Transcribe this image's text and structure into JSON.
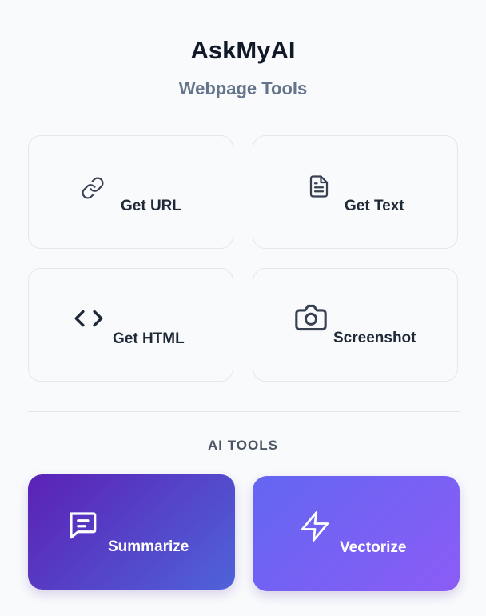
{
  "app": {
    "title": "AskMyAI",
    "subtitle": "Webpage Tools"
  },
  "tools": [
    {
      "label": "Get URL",
      "icon": "link-icon"
    },
    {
      "label": "Get Text",
      "icon": "document-icon"
    },
    {
      "label": "Get HTML",
      "icon": "code-icon"
    },
    {
      "label": "Screenshot",
      "icon": "camera-icon"
    }
  ],
  "ai_section": {
    "heading": "AI TOOLS",
    "tools": [
      {
        "label": "Summarize",
        "icon": "chat-icon"
      },
      {
        "label": "Vectorize",
        "icon": "lightning-icon"
      }
    ]
  },
  "colors": {
    "background": "#f8fafc",
    "card_background": "#f9fafb",
    "card_border": "#e5e7eb",
    "summarize_gradient": [
      "#5b21b6",
      "#4f63d9"
    ],
    "vectorize_gradient": [
      "#6366f1",
      "#8b5cf6"
    ]
  }
}
